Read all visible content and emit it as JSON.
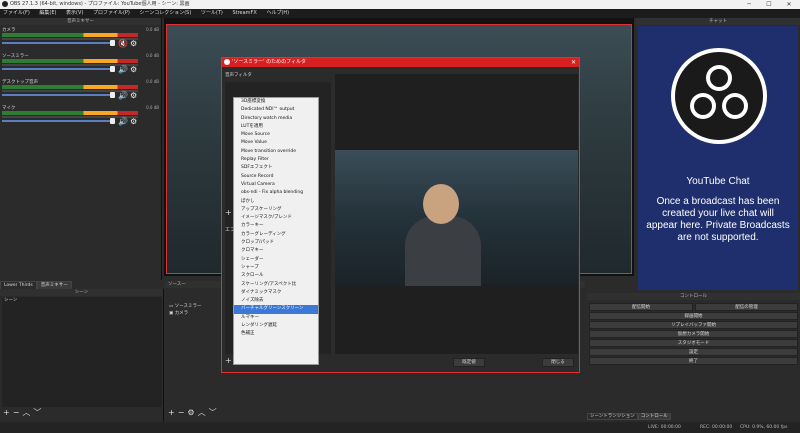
{
  "titlebar": {
    "title": "OBS 27.1.3 (64-bit, windows) - プロファイル: YouTube個人用 - シーン: 黒画"
  },
  "menubar": {
    "items": [
      "ファイル(F)",
      "編集(E)",
      "表示(V)",
      "プロファイル(P)",
      "シーンコレクション(S)",
      "ツール(T)",
      "StreamFX",
      "ヘルプ(H)"
    ]
  },
  "mixer": {
    "title": "音声ミキサー",
    "channels": [
      {
        "name": "カメラ",
        "db": "0.0 dB",
        "muted": true
      },
      {
        "name": "ソースミラー",
        "db": "0.0 dB",
        "muted": false
      },
      {
        "name": "デスクトップ音声",
        "db": "0.0 dB",
        "muted": false
      },
      {
        "name": "マイク",
        "db": "0.0 dB",
        "muted": false
      }
    ]
  },
  "chat": {
    "dock_title": "チャット",
    "title": "YouTube Chat",
    "message": "Once a broadcast has been created your live chat will appear here. Private Broadcasts are not supported."
  },
  "bottom_tabs": {
    "tab1": "Lower Thirds",
    "tab2": "音声ミキサー",
    "sources_tab": "ソースー"
  },
  "scenes": {
    "title": "シーン",
    "items": [
      "シーン"
    ]
  },
  "sources": {
    "items": [
      "ソースミラー",
      "カメラ"
    ]
  },
  "controls": {
    "title": "コントロール",
    "buttons": [
      "配信開始",
      "録画開始",
      "リプレイバッファ開始",
      "仮想カメラ開始",
      "スタジオモード",
      "設定",
      "終了"
    ],
    "manage": "配信の管理",
    "tab_transitions": "シーントランジション",
    "tab_controls": "コントロール"
  },
  "status": {
    "live": "LIVE: 00:00:00",
    "rec": "REC: 00:00:00",
    "cpu": "CPU: 0.9%, 60.00 fps"
  },
  "filter_dialog": {
    "title": "'ソースミラー' のためのフィルタ",
    "audio_filters": "音声フィルタ",
    "effect_label": "エフ",
    "defaults_button": "既定値",
    "close_button": "閉じる",
    "menu_items": [
      "3D座標変換",
      "Dedicated NDI™ output",
      "Directory watch media",
      "LUTを適用",
      "Move Source",
      "Move Value",
      "Move transition override",
      "Replay Filter",
      "SDFエフェクト",
      "Source Record",
      "Virtual Camera",
      "obs-ndi - Fix alpha blending",
      "ぼかし",
      "アップスケーリング",
      "イメージマスク/ブレンド",
      "カラーキー",
      "カラーグレーディング",
      "クロップ/パッド",
      "クロマキー",
      "シェーダー",
      "シャープ",
      "スクロール",
      "スケーリング/アスペクト比",
      "ダイナミックマスク",
      "ノイズ除去",
      "バーチャルグリーンスクリーン",
      "ルマキー",
      "レンダリング遅延",
      "色補正"
    ],
    "selected_index": 25
  }
}
